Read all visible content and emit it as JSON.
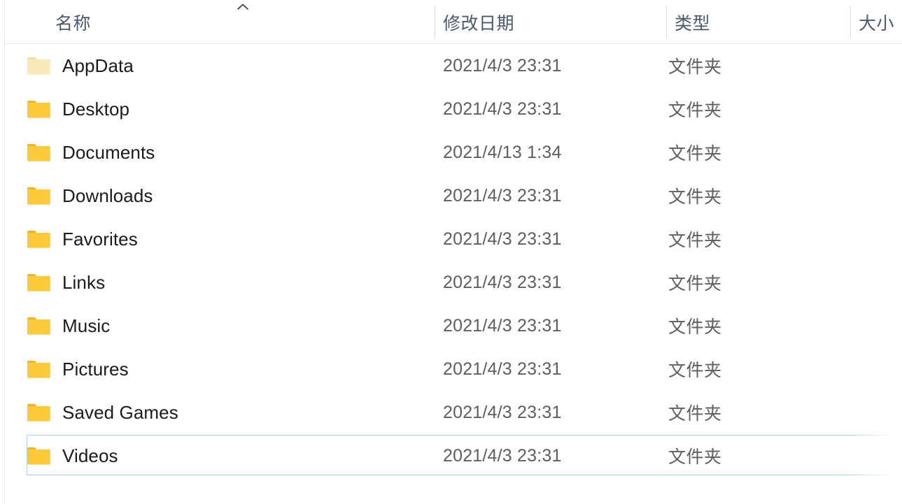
{
  "window": {
    "app": "file-explorer",
    "view_mode": "details"
  },
  "columns": [
    {
      "key": "name",
      "label": "名称",
      "sorted": true,
      "sort_direction": "ascending",
      "sort_glyph": "caret-up"
    },
    {
      "key": "date_modified",
      "label": "修改日期"
    },
    {
      "key": "type",
      "label": "类型"
    },
    {
      "key": "size",
      "label": "大小"
    }
  ],
  "colors": {
    "header_text": "#4a5a6e",
    "row_text": "#1b1b1b",
    "meta_text": "#5e5e5e",
    "folder_body": "#ffc93c",
    "folder_tab": "#f0b429",
    "folder_body_dim": "#fae9bb",
    "folder_tab_dim": "#f3dca0",
    "selection_border": "#a8cfe8",
    "divider": "#e8e8e8"
  },
  "rows": [
    {
      "name": "AppData",
      "date_modified": "2021/4/3 23:31",
      "type": "文件夹",
      "size": "",
      "icon": "folder-icon",
      "dimmed": true,
      "selected": false
    },
    {
      "name": "Desktop",
      "date_modified": "2021/4/3 23:31",
      "type": "文件夹",
      "size": "",
      "icon": "folder-icon",
      "dimmed": false,
      "selected": false
    },
    {
      "name": "Documents",
      "date_modified": "2021/4/13 1:34",
      "type": "文件夹",
      "size": "",
      "icon": "folder-icon",
      "dimmed": false,
      "selected": false
    },
    {
      "name": "Downloads",
      "date_modified": "2021/4/3 23:31",
      "type": "文件夹",
      "size": "",
      "icon": "folder-icon",
      "dimmed": false,
      "selected": false
    },
    {
      "name": "Favorites",
      "date_modified": "2021/4/3 23:31",
      "type": "文件夹",
      "size": "",
      "icon": "folder-icon",
      "dimmed": false,
      "selected": false
    },
    {
      "name": "Links",
      "date_modified": "2021/4/3 23:31",
      "type": "文件夹",
      "size": "",
      "icon": "folder-icon",
      "dimmed": false,
      "selected": false
    },
    {
      "name": "Music",
      "date_modified": "2021/4/3 23:31",
      "type": "文件夹",
      "size": "",
      "icon": "folder-icon",
      "dimmed": false,
      "selected": false
    },
    {
      "name": "Pictures",
      "date_modified": "2021/4/3 23:31",
      "type": "文件夹",
      "size": "",
      "icon": "folder-icon",
      "dimmed": false,
      "selected": false
    },
    {
      "name": "Saved Games",
      "date_modified": "2021/4/3 23:31",
      "type": "文件夹",
      "size": "",
      "icon": "folder-icon",
      "dimmed": false,
      "selected": false
    },
    {
      "name": "Videos",
      "date_modified": "2021/4/3 23:31",
      "type": "文件夹",
      "size": "",
      "icon": "folder-icon",
      "dimmed": false,
      "selected": true
    }
  ]
}
